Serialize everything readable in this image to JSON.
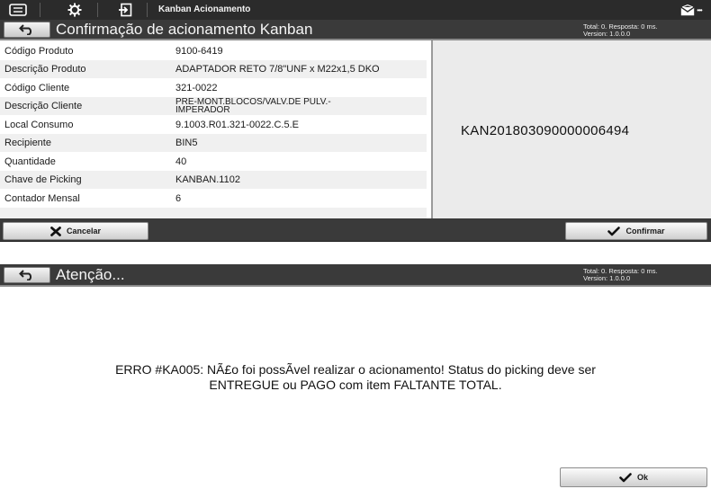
{
  "topbar": {
    "title": "Kanban Acionamento",
    "icons": [
      "menu-icon",
      "gear-icon",
      "exit-icon",
      "mail-icon"
    ]
  },
  "header": {
    "title": "Confirmação de acionamento Kanban",
    "status_line1": "Total: 0. Resposta: 0 ms.",
    "status_line2": "Version: 1.0.0.0"
  },
  "details": {
    "rows": [
      {
        "label": "Código Produto",
        "value": "9100-6419"
      },
      {
        "label": "Descrição Produto",
        "value": "ADAPTADOR RETO 7/8\"UNF x M22x1,5 DKO"
      },
      {
        "label": "Código Cliente",
        "value": "321-0022"
      },
      {
        "label": "Descrição Cliente",
        "value_line1": "PRE-MONT.BLOCOS/VALV.DE PULV.-",
        "value_line2": "IMPERADOR"
      },
      {
        "label": "Local Consumo",
        "value": "9.1003.R01.321-0022.C.5.E"
      },
      {
        "label": "Recipiente",
        "value": "BIN5"
      },
      {
        "label": "Quantidade",
        "value": "40"
      },
      {
        "label": "Chave de Picking",
        "value": "KANBAN.1102"
      },
      {
        "label": "Contador Mensal",
        "value": "6"
      }
    ]
  },
  "kanban_code": "KAN201803090000006494",
  "actions": {
    "cancel_label": "Cancelar",
    "confirm_label": "Confirmar"
  },
  "dialog": {
    "title": "Atenção...",
    "status_line1": "Total: 0. Resposta: 0 ms.",
    "status_line2": "Version: 1.0.0.0",
    "message_line1": "ERRO #KA005: NÃ£o foi possÃ­vel realizar o acionamento! Status do picking deve ser",
    "message_line2": "ENTREGUE ou PAGO com item FALTANTE TOTAL.",
    "ok_label": "Ok"
  },
  "colors": {
    "bar": "#3a3a3a",
    "topbar": "#2b2b2b",
    "row_alt": "#f0f0f0",
    "panel": "#ebebeb"
  }
}
